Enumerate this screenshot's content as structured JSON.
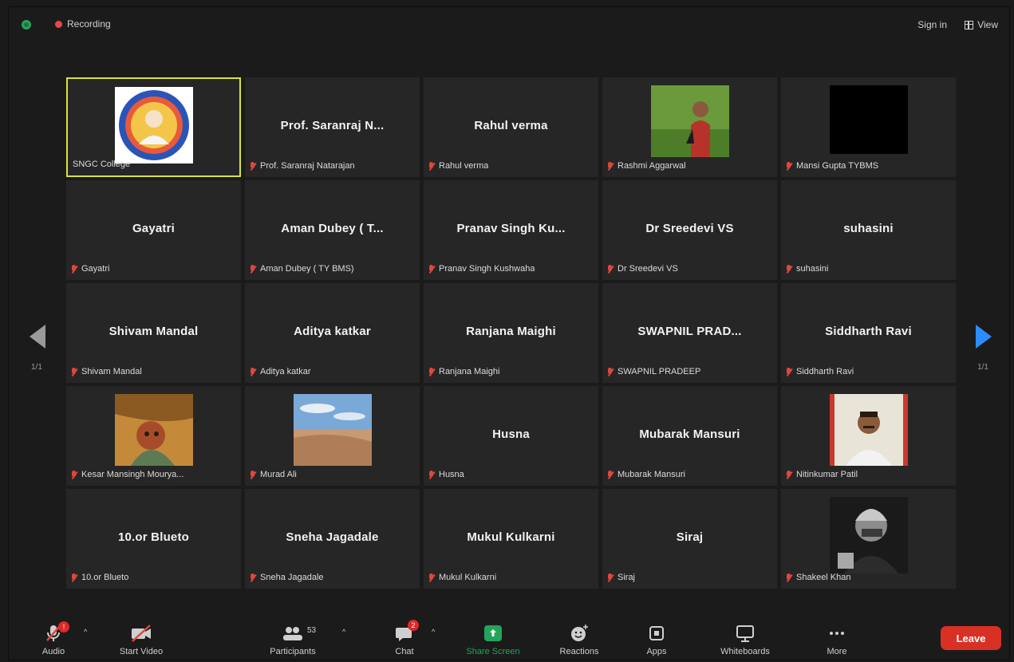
{
  "topbar": {
    "recording_label": "Recording",
    "signin_label": "Sign in",
    "view_label": "View"
  },
  "pagination": {
    "left": "1/1",
    "right": "1/1"
  },
  "participants": [
    {
      "display": "",
      "label": "SNGC College",
      "photo": "logo",
      "active": true
    },
    {
      "display": "Prof. Saranraj N...",
      "label": "Prof. Saranraj Natarajan"
    },
    {
      "display": "Rahul verma",
      "label": "Rahul verma"
    },
    {
      "display": "",
      "label": "Rashmi Aggarwal",
      "photo": "green-person"
    },
    {
      "display": "",
      "label": "Mansi Gupta TYBMS",
      "photo": "black"
    },
    {
      "display": "Gayatri",
      "label": "Gayatri"
    },
    {
      "display": "Aman Dubey ( T...",
      "label": "Aman Dubey ( TY BMS)"
    },
    {
      "display": "Pranav Singh Ku...",
      "label": "Pranav Singh Kushwaha"
    },
    {
      "display": "Dr Sreedevi VS",
      "label": "Dr Sreedevi VS"
    },
    {
      "display": "suhasini",
      "label": "suhasini"
    },
    {
      "display": "Shivam Mandal",
      "label": "Shivam Mandal"
    },
    {
      "display": "Aditya katkar",
      "label": "Aditya katkar"
    },
    {
      "display": "Ranjana Maighi",
      "label": "Ranjana Maighi"
    },
    {
      "display": "SWAPNIL PRAD...",
      "label": "SWAPNIL PRADEEP"
    },
    {
      "display": "Siddharth Ravi",
      "label": "Siddharth Ravi"
    },
    {
      "display": "",
      "label": "Kesar Mansingh Mourya...",
      "photo": "painting"
    },
    {
      "display": "",
      "label": "Murad Ali",
      "photo": "landscape"
    },
    {
      "display": "Husna",
      "label": "Husna"
    },
    {
      "display": "Mubarak Mansuri",
      "label": "Mubarak Mansuri"
    },
    {
      "display": "",
      "label": "Nitinkumar Patil",
      "photo": "portrait"
    },
    {
      "display": "10.or Blueto",
      "label": "10.or Blueto"
    },
    {
      "display": "Sneha Jagadale",
      "label": "Sneha Jagadale"
    },
    {
      "display": "Mukul Kulkarni",
      "label": "Mukul Kulkarni"
    },
    {
      "display": "Siraj",
      "label": "Siraj"
    },
    {
      "display": "",
      "label": "Shakeel Khan",
      "photo": "dark-portrait"
    }
  ],
  "toolbar": {
    "audio": "Audio",
    "start_video": "Start Video",
    "participants": "Participants",
    "participant_count": "53",
    "chat": "Chat",
    "chat_badge": "2",
    "share_screen": "Share Screen",
    "reactions": "Reactions",
    "apps": "Apps",
    "whiteboards": "Whiteboards",
    "more": "More",
    "leave": "Leave"
  },
  "colors": {
    "accent_green": "#23a45a",
    "active_speaker": "#d9e23c",
    "leave_red": "#d93025",
    "nav_blue": "#2d8cff"
  }
}
